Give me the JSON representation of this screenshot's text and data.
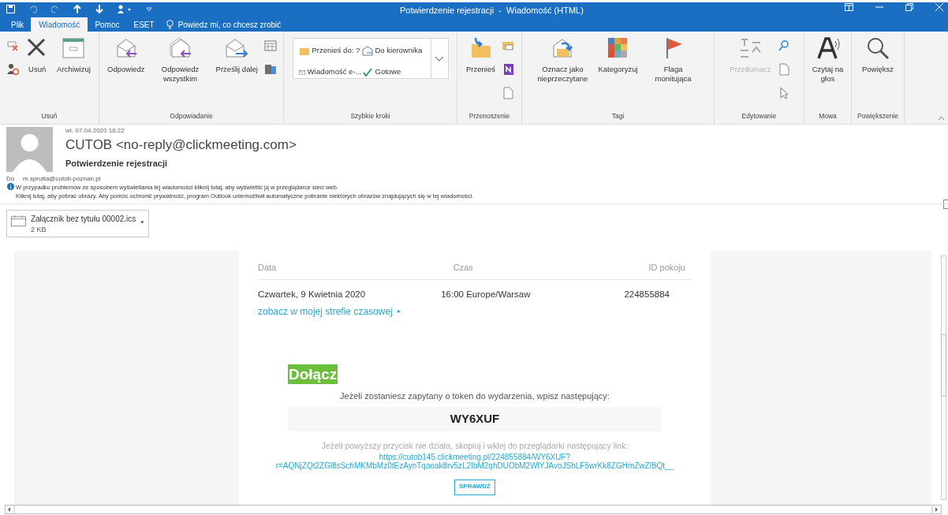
{
  "window": {
    "title": "Potwierdzenie rejestracji  -  Wiadomość (HTML)"
  },
  "tabs": [
    {
      "label": "Plik",
      "selected": false
    },
    {
      "label": "Wiadomość",
      "selected": true
    },
    {
      "label": "Pomoc",
      "selected": false
    },
    {
      "label": "ESET",
      "selected": false
    }
  ],
  "tell_me": "Powiedz mi, co chcesz zrobić",
  "ribbon": [
    {
      "label": "Usuń",
      "buttons": [
        {
          "label": "Usuń",
          "disabled": false
        },
        {
          "label": "Archiwizuj",
          "disabled": false
        }
      ]
    },
    {
      "label": "Odpowiadanie",
      "buttons": [
        {
          "label": "Odpowiedz",
          "disabled": false
        },
        {
          "label": "Odpowiedz wszystkim",
          "disabled": false
        },
        {
          "label": "Prześlij dalej",
          "disabled": false
        }
      ]
    },
    {
      "label": "Szybkie kroki",
      "quick_steps": [
        "Przenieś do: ?",
        "Do kierownika",
        "Wiadomość e-...",
        "Gotowe"
      ]
    },
    {
      "label": "Przenoszenie",
      "buttons": [
        {
          "label": "Przenieś",
          "disabled": false
        }
      ]
    },
    {
      "label": "Tagi",
      "buttons": [
        {
          "label": "Oznacz jako nieprzeczytane",
          "disabled": false
        },
        {
          "label": "Kategoryzuj",
          "disabled": false
        },
        {
          "label": "Flaga monitująca",
          "disabled": false
        }
      ]
    },
    {
      "label": "Edytowanie",
      "buttons": [
        {
          "label": "Przetłumacz",
          "disabled": true
        }
      ]
    },
    {
      "label": "Mowa",
      "buttons": [
        {
          "label": "Czytaj na głos",
          "disabled": false
        }
      ]
    },
    {
      "label": "Powiększenie",
      "buttons": [
        {
          "label": "Powiększ",
          "disabled": false
        }
      ]
    }
  ],
  "header": {
    "date": "wt. 07.04.2020 16:22",
    "sender": "CUTOB <no-reply@clickmeeting.com>",
    "subject": "Potwierdzenie rejestracji",
    "to_label": "Do",
    "to": "m.sprutta@cutob-poznan.pl",
    "info": [
      "W przypadku problemów ze sposobem wyświetlania tej wiadomości kliknij tutaj, aby wyświetlić ją w przeglądarce sieci web.",
      "Kliknij tutaj, aby pobrać obrazy. Aby pomóc ochronić prywatność, program Outlook uniemożliwił automatyczne pobranie niektórych obrazów znajdujących się w tej wiadomości."
    ],
    "attachment": {
      "name": "Załącznik bez tytułu 00002.ics",
      "size": "2 KB"
    }
  },
  "email": {
    "columns": [
      "Data",
      "Czas",
      "ID pokoju"
    ],
    "row": [
      "Czwartek, 9 Kwietnia 2020",
      "16:00 Europe/Warsaw",
      "224855884"
    ],
    "timezone_link": "zobacz w mojej strefie czasowej",
    "timezone_arrow": "▸",
    "join": "Dołącz",
    "token_prompt": "Jeżeli zostaniesz zapytany o token do wydarzenia, wpisz następujący:",
    "token": "WY6XUF",
    "fallback": "Jeżeli powyższy przycisk nie działa, skopiuj i wklej do przeglądarki następujący link:",
    "url": [
      "https://cutob145.clickmeeting.pl/224855884/WY6XUF?",
      "r=AQNjZQt2ZGl8sSchMKMbMz0tEzAynTqaoak8rv5zL2IbM2qhDUObM2WlYJAvoJShLF5wrKk8ZGHmZwZlBQt__"
    ],
    "check_button": "SPRAWDŹ"
  }
}
